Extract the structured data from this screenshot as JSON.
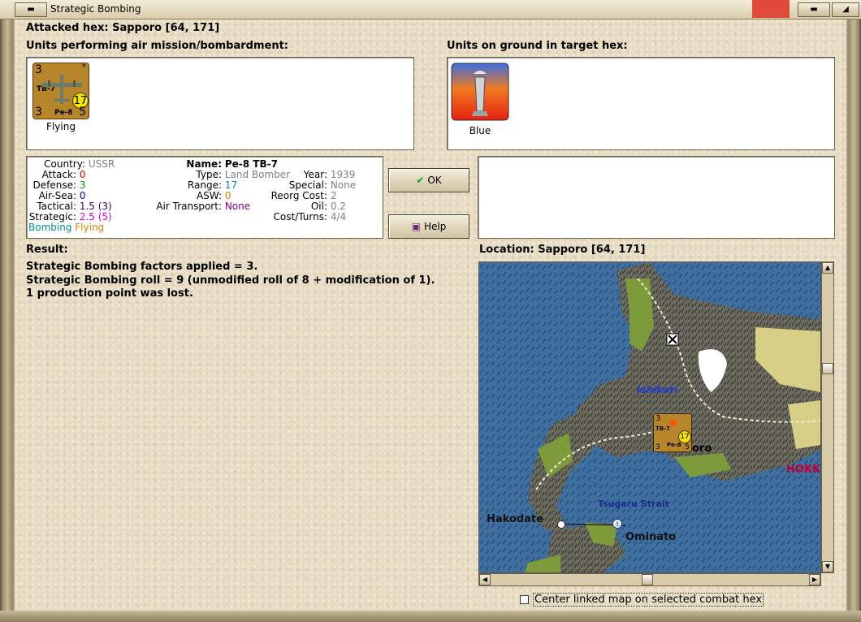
{
  "window": {
    "title": "Strategic Bombing"
  },
  "header": {
    "attacked_hex": "Attacked hex: Sapporo  [64, 171]"
  },
  "air_units": {
    "label": "Units performing air mission/bombardment:",
    "items": [
      {
        "status": "Flying",
        "counter": {
          "top_left": "3",
          "top_right": "*",
          "bottom_left": "3",
          "bottom_right": "5",
          "range": "17",
          "name_top": "TB-7",
          "name_bottom": "Pe-8"
        }
      }
    ]
  },
  "ground_units": {
    "label": "Units on ground in target hex:",
    "items": [
      {
        "status": "Blue"
      }
    ]
  },
  "unit_info": {
    "country_label": "Country:",
    "country": "USSR",
    "attack_label": "Attack:",
    "attack": "0",
    "defense_label": "Defense:",
    "defense": "3",
    "airsea_label": "Air-Sea:",
    "airsea": "0",
    "tactical_label": "Tactical:",
    "tactical": "1.5 (3)",
    "strategic_label": "Strategic:",
    "strategic": "2.5 (5)",
    "mission": "Bombing",
    "state": "Flying",
    "name_label": "Name:",
    "name": "Pe-8 TB-7",
    "type_label": "Type:",
    "type": "Land Bomber",
    "range_label": "Range:",
    "range": "17",
    "asw_label": "ASW:",
    "asw": "0",
    "air_transport_label": "Air Transport:",
    "air_transport": "None",
    "year_label": "Year:",
    "year": "1939",
    "special_label": "Special:",
    "special": "None",
    "reorg_label": "Reorg Cost:",
    "reorg": "2",
    "oil_label": "Oil:",
    "oil": "0.2",
    "cost_label": "Cost/Turns:",
    "cost": "4/4"
  },
  "buttons": {
    "ok": "OK",
    "help": "Help"
  },
  "result": {
    "label": "Result:",
    "lines": [
      "Strategic Bombing factors applied = 3.",
      "Strategic Bombing roll = 9 (unmodified roll of 8 + modification of 1).",
      "1 production point was lost."
    ]
  },
  "location": {
    "label": "Location:  Sapporo  [64, 171]",
    "map_labels": {
      "ishikari": "Ishikari",
      "sapporo": "oro",
      "hokkaido": "HOKK",
      "hakodate": "Hakodate",
      "tsugaru": "Tsugaru Strait",
      "ominato": "Ominato"
    },
    "counter": {
      "top_left": "3",
      "name_top": "TB-7",
      "name_bottom": "Pe-8",
      "range": "17",
      "bottom_left": "3",
      "bottom_right": "5"
    }
  },
  "center_map": {
    "label": "Center linked map on selected combat hex",
    "checked": false
  },
  "colors": {
    "sea": "#3f6f9e",
    "land": "#6b6b60",
    "grass": "#7d9b3a",
    "sand": "#d7cf86",
    "counter_brown": "#b8862a"
  }
}
